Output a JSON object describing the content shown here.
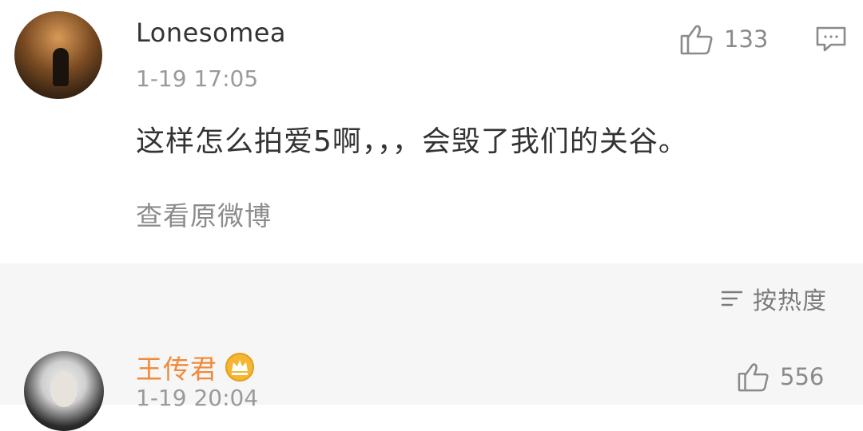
{
  "comments": [
    {
      "username": "Lonesomea",
      "timestamp": "1-19 17:05",
      "likes": "133",
      "text": "这样怎么拍爱5啊，，，会毁了我们的关谷。",
      "view_original": "查看原微博",
      "icons": [
        "avatar",
        "like-icon",
        "comment-icon"
      ]
    },
    {
      "username": "王传君",
      "timestamp": "1-19 20:04",
      "likes": "556",
      "icons": [
        "avatar",
        "vip-crown-badge-icon",
        "like-icon"
      ]
    }
  ],
  "sort": {
    "label": "按热度",
    "icon": "sort-lines-icon"
  },
  "colors": {
    "background": "#ffffff",
    "band": "#f7f6f7",
    "text": "#333333",
    "muted": "#9a9a9a",
    "vip_name": "#f08a3a",
    "vip_badge": "#f5b731"
  }
}
